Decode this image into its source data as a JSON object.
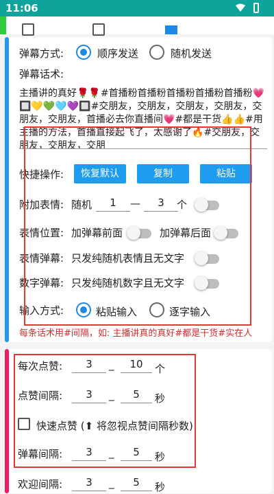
{
  "status": {
    "time": "11:06"
  },
  "barrage": {
    "mode_label": "弹幕方式:",
    "mode_options": [
      "顺序发送",
      "随机发送"
    ],
    "speech_label": "弹幕话术:",
    "speech_text": "主播讲的真好🌹🌹#首播粉首播粉首播粉首播粉首播粉💗🔲💛💚🩵💜🔲#交朋友，交朋友，交朋友，交朋友，交朋友，交朋友，首播必去你直播间💗#都是干货👍👍#用主播的方法，首播直接起飞了，太感谢了🔥#交朋友，交朋友，交朋友，交朋"
  },
  "quick_ops": {
    "label": "快捷操作:",
    "restore": "恢复默认",
    "copy": "复制",
    "paste": "粘贴"
  },
  "emoji_add": {
    "label": "附加表情:",
    "random": "随机",
    "min": "1",
    "dash": "—",
    "max": "3",
    "unit": "个"
  },
  "emoji_pos": {
    "label": "表情位置:",
    "front": "加弹幕前面",
    "back": "加弹幕后面"
  },
  "emoji_barrage": {
    "label": "表情弹幕:",
    "desc": "只发纯随机表情且无文字"
  },
  "number_barrage": {
    "label": "数字弹幕:",
    "desc": "只发纯随机数字且无文字"
  },
  "input_mode": {
    "label": "输入方式:",
    "options": [
      "粘贴输入",
      "逐字输入"
    ]
  },
  "hint": "每条话术用#间隔，如: 主播讲真的真好#都是干货#实在人",
  "likes": {
    "per_label": "每次点赞:",
    "per_min": "3",
    "per_max": "10",
    "per_unit": "个",
    "interval_label": "点赞间隔:",
    "interval_min": "3",
    "interval_max": "5",
    "interval_unit": "秒",
    "fast_label": "快速点赞 (⬆ 将忽视点赞间隔秒数)",
    "barrage_interval_label": "弹幕间隔:",
    "barrage_min": "3",
    "barrage_max": "5",
    "barrage_unit": "秒",
    "welcome_label": "欢迎间隔:",
    "welcome_min": "3",
    "welcome_max": "5",
    "welcome_unit": "秒",
    "dash": "_"
  },
  "colors": {
    "status": "#0fa49b",
    "accent": "#1e88e5",
    "button": "#1e9cf0",
    "highlight": "#e53935",
    "side1": "#2196f3",
    "side2": "#e91e63"
  }
}
